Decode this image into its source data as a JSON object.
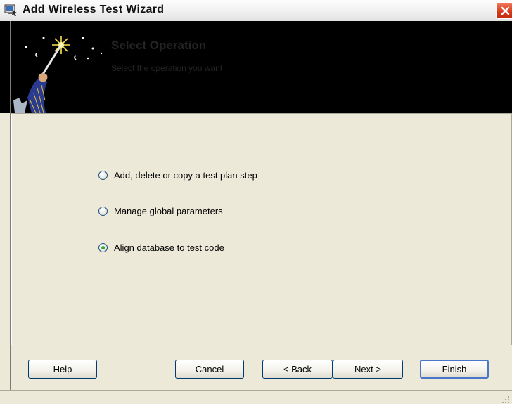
{
  "window": {
    "title": "Add Wireless Test Wizard",
    "icons": {
      "app": "app-icon",
      "close": "close-icon"
    }
  },
  "banner": {
    "title": "Select Operation",
    "subtitle": "Select the operation you want",
    "image": "wizard-wand-image",
    "background_color": "#000000"
  },
  "options": [
    {
      "label": "Add, delete or copy a test plan step",
      "selected": false
    },
    {
      "label": "Manage global parameters",
      "selected": false
    },
    {
      "label": "Align database to test code",
      "selected": true
    }
  ],
  "buttons": {
    "help": "Help",
    "cancel": "Cancel",
    "back": "< Back",
    "next": "Next >",
    "finish": "Finish"
  },
  "colors": {
    "dialog_bg": "#ece9d8",
    "close_red": "#d9381b",
    "radio_selected_dot": "#21a121",
    "button_border": "#003c74"
  }
}
